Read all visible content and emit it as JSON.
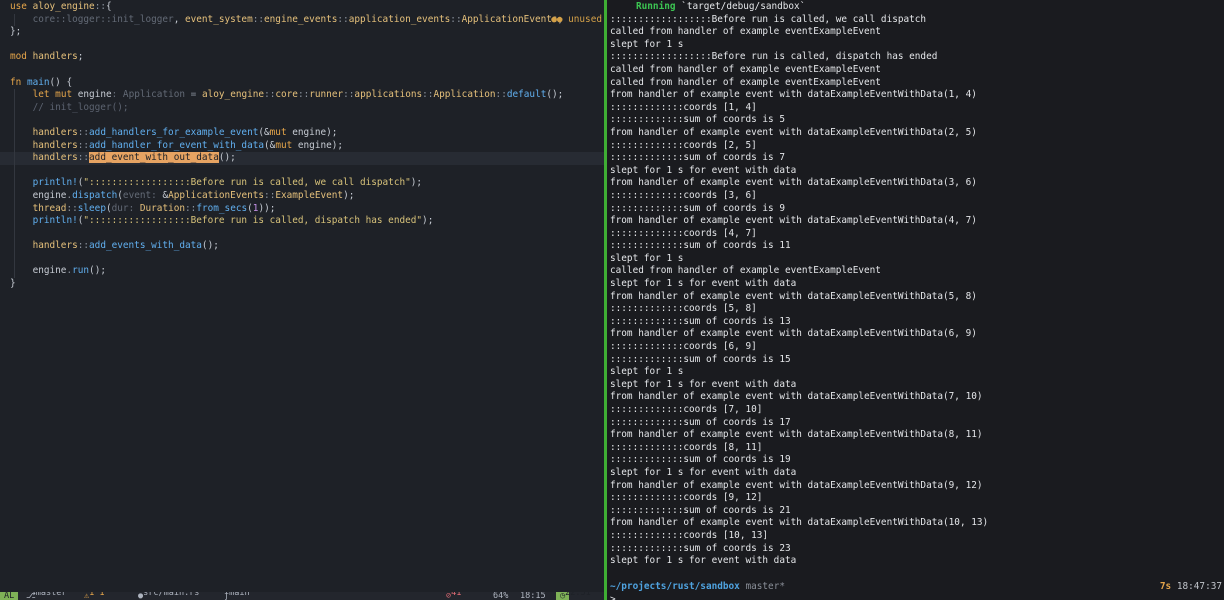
{
  "editor": {
    "unused_label": "unused",
    "lines": [
      "use aloy_engine::{",
      "    core::logger::init_logger, event_system::engine_events::application_events::ApplicationEvents,",
      "};",
      "",
      "mod handlers;",
      "",
      "fn main() {",
      "    let mut engine: Application = aloy_engine::core::runner::applications::Application::default();",
      "    // init_logger();",
      "",
      "    handlers::add_handlers_for_example_event(&mut engine);",
      "    handlers::add_handler_for_event_with_data(&mut engine);",
      "    handlers::add_event_with_out_data();",
      "",
      "    println!(\"::::::::::::::::::Before run is called, we call dispatch\");",
      "    engine.dispatch(event: &ApplicationEvents::ExampleEvent);",
      "    thread::sleep(dur: Duration::from_secs(1));",
      "    println!(\"::::::::::::::::::Before run is called, dispatch has ended\");",
      "",
      "    handlers::add_events_with_data();",
      "",
      "    engine.run();",
      "}"
    ],
    "statusbar": {
      "mode": "AL",
      "branch": "master",
      "diagnostics": "1 1",
      "file": "src/main.rs",
      "symbol": "main",
      "errors": "41",
      "percent": "64%",
      "position": "18:15",
      "time": "22:51"
    }
  },
  "terminal": {
    "running_word": "Running",
    "running_target": "`target/debug/sandbox`",
    "output": [
      "::::::::::::::::::Before run is called, we call dispatch",
      "called from handler of example eventExampleEvent",
      "slept for 1 s",
      "::::::::::::::::::Before run is called, dispatch has ended",
      "called from handler of example eventExampleEvent",
      "called from handler of example eventExampleEvent",
      "from handler of example event with dataExampleEventWithData(1, 4)",
      ":::::::::::::coords [1, 4]",
      ":::::::::::::sum of coords is 5",
      "from handler of example event with dataExampleEventWithData(2, 5)",
      ":::::::::::::coords [2, 5]",
      ":::::::::::::sum of coords is 7",
      "slept for 1 s for event with data",
      "from handler of example event with dataExampleEventWithData(3, 6)",
      ":::::::::::::coords [3, 6]",
      ":::::::::::::sum of coords is 9",
      "from handler of example event with dataExampleEventWithData(4, 7)",
      ":::::::::::::coords [4, 7]",
      ":::::::::::::sum of coords is 11",
      "slept for 1 s",
      "called from handler of example eventExampleEvent",
      "slept for 1 s for event with data",
      "from handler of example event with dataExampleEventWithData(5, 8)",
      ":::::::::::::coords [5, 8]",
      ":::::::::::::sum of coords is 13",
      "from handler of example event with dataExampleEventWithData(6, 9)",
      ":::::::::::::coords [6, 9]",
      ":::::::::::::sum of coords is 15",
      "slept for 1 s",
      "slept for 1 s for event with data",
      "from handler of example event with dataExampleEventWithData(7, 10)",
      ":::::::::::::coords [7, 10]",
      ":::::::::::::sum of coords is 17",
      "from handler of example event with dataExampleEventWithData(8, 11)",
      ":::::::::::::coords [8, 11]",
      ":::::::::::::sum of coords is 19",
      "slept for 1 s for event with data",
      "from handler of example event with dataExampleEventWithData(9, 12)",
      ":::::::::::::coords [9, 12]",
      ":::::::::::::sum of coords is 21",
      "from handler of example event with dataExampleEventWithData(10, 13)",
      ":::::::::::::coords [10, 13]",
      ":::::::::::::sum of coords is 23",
      "slept for 1 s for event with data"
    ],
    "prompt_path": "~/projects/rust/sandbox",
    "prompt_branch": "master*",
    "duration": "7s",
    "clock": "18:47:37",
    "caret": ">"
  }
}
